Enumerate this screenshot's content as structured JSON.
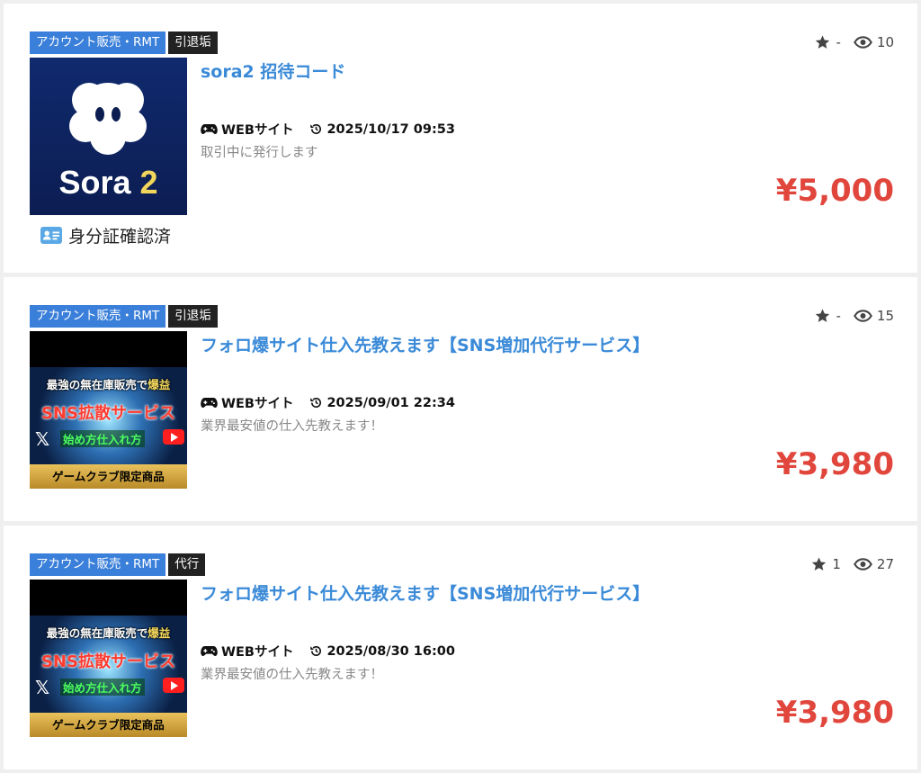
{
  "listings": [
    {
      "category_tag": "アカウント販売・RMT",
      "type_tag": "引退垢",
      "rating": "-",
      "views": "10",
      "title": "sora2 招待コード",
      "platform": "WEBサイト",
      "date": "2025/10/17 09:53",
      "description": "取引中に発行します",
      "price": "¥5,000",
      "verified_label": "身分証確認済",
      "thumbnail": {
        "logo_text": "Sora",
        "logo_num": "2"
      }
    },
    {
      "category_tag": "アカウント販売・RMT",
      "type_tag": "引退垢",
      "rating": "-",
      "views": "15",
      "title": "フォロ爆サイト仕入先教えます【SNS増加代行サービス】",
      "platform": "WEBサイト",
      "date": "2025/09/01 22:34",
      "description": "業界最安値の仕入先教えます！",
      "price": "¥3,980",
      "thumbnail": {
        "line1a": "最強の無在庫販売で",
        "line1b": "爆益",
        "line2": "SNS拡散サービス",
        "line3": "始め方仕入れ方",
        "band": "ゲームクラブ限定商品"
      }
    },
    {
      "category_tag": "アカウント販売・RMT",
      "type_tag": "代行",
      "rating": "1",
      "views": "27",
      "title": "フォロ爆サイト仕入先教えます【SNS増加代行サービス】",
      "platform": "WEBサイト",
      "date": "2025/08/30 16:00",
      "description": "業界最安値の仕入先教えます！",
      "price": "¥3,980",
      "thumbnail": {
        "line1a": "最強の無在庫販売で",
        "line1b": "爆益",
        "line2": "SNS拡散サービス",
        "line3": "始め方仕入れ方",
        "band": "ゲームクラブ限定商品"
      }
    }
  ],
  "icons": {
    "star": "star-icon",
    "views": "eye-icon",
    "platform": "gamepad-icon",
    "date": "history-icon",
    "verified": "id-card-icon"
  },
  "colors": {
    "title": "#3a8ad8",
    "price": "#e1463c",
    "category_tag": "#3a7fd9",
    "type_tag": "#222222"
  }
}
